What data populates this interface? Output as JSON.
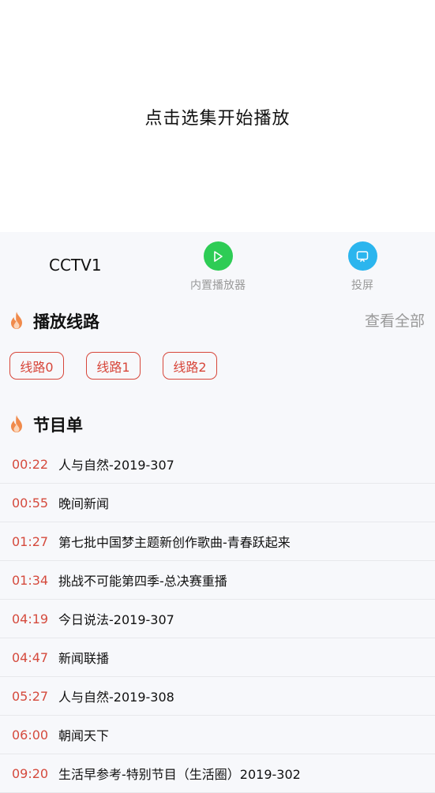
{
  "player": {
    "hint": "点击选集开始播放"
  },
  "info": {
    "channel": "CCTV1",
    "builtin_player_label": "内置播放器",
    "cast_label": "投屏"
  },
  "routes_section": {
    "title": "播放线路",
    "view_all": "查看全部",
    "routes": [
      "线路0",
      "线路1",
      "线路2"
    ]
  },
  "programs_section": {
    "title": "节目单",
    "items": [
      {
        "time": "00:22",
        "title": "人与自然-2019-307"
      },
      {
        "time": "00:55",
        "title": "晚间新闻"
      },
      {
        "time": "01:27",
        "title": "第七批中国梦主题新创作歌曲-青春跃起来"
      },
      {
        "time": "01:34",
        "title": "挑战不可能第四季-总决赛重播"
      },
      {
        "time": "04:19",
        "title": "今日说法-2019-307"
      },
      {
        "time": "04:47",
        "title": "新闻联播"
      },
      {
        "time": "05:27",
        "title": "人与自然-2019-308"
      },
      {
        "time": "06:00",
        "title": "朝闻天下"
      },
      {
        "time": "09:20",
        "title": "生活早参考-特别节目（生活圈）2019-302"
      }
    ]
  },
  "colors": {
    "accent_red": "#d7463a",
    "play_green": "#2ecc55",
    "cast_blue": "#2bb5ee",
    "flame_orange": "#f08a4b"
  }
}
